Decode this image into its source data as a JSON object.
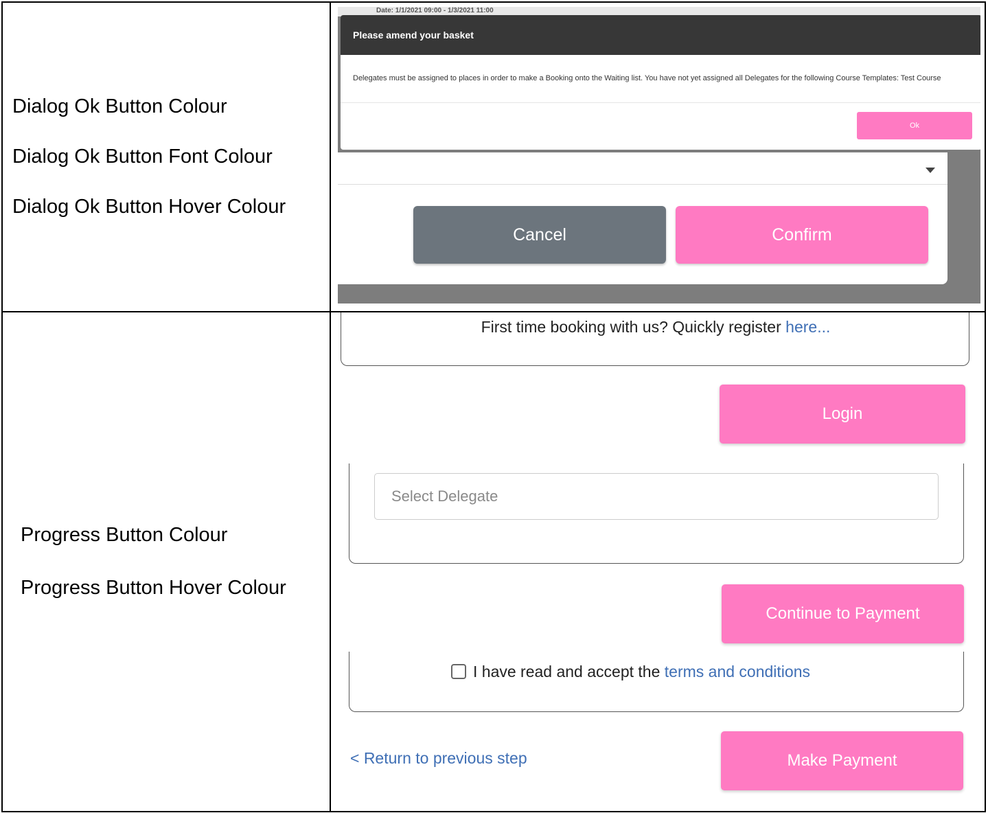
{
  "row1": {
    "labels": [
      "Dialog Ok Button Colour",
      "Dialog Ok Button Font Colour",
      "Dialog Ok Button Hover Colour"
    ],
    "background_text": "Date: 1/1/2021 09:00 - 1/3/2021 11:00",
    "dialog": {
      "title": "Please amend your basket",
      "message": "Delegates must be assigned to places in order to make a Booking onto the Waiting list. You have not yet assigned all Delegates for the following Course Templates: Test Course",
      "ok_label": "Ok"
    },
    "cancel_label": "Cancel",
    "confirm_label": "Confirm"
  },
  "row2": {
    "labels": [
      "Progress Button Colour",
      "Progress Button Hover Colour"
    ],
    "register_text": "First time booking with us? Quickly register ",
    "register_link": "here...",
    "login_label": "Login",
    "delegate_placeholder": "Select Delegate",
    "continue_label": "Continue to Payment",
    "terms_text": "I have read and accept the ",
    "terms_link": "terms and conditions",
    "return_link": "< Return to previous step",
    "pay_label": "Make Payment"
  },
  "colors": {
    "progress_button": "#ff7ac2",
    "cancel_button": "#6c757d",
    "dialog_header": "#373737",
    "link": "#3f6fb5"
  },
  "icons": [
    "chevron-down-icon",
    "checkbox-icon"
  ]
}
